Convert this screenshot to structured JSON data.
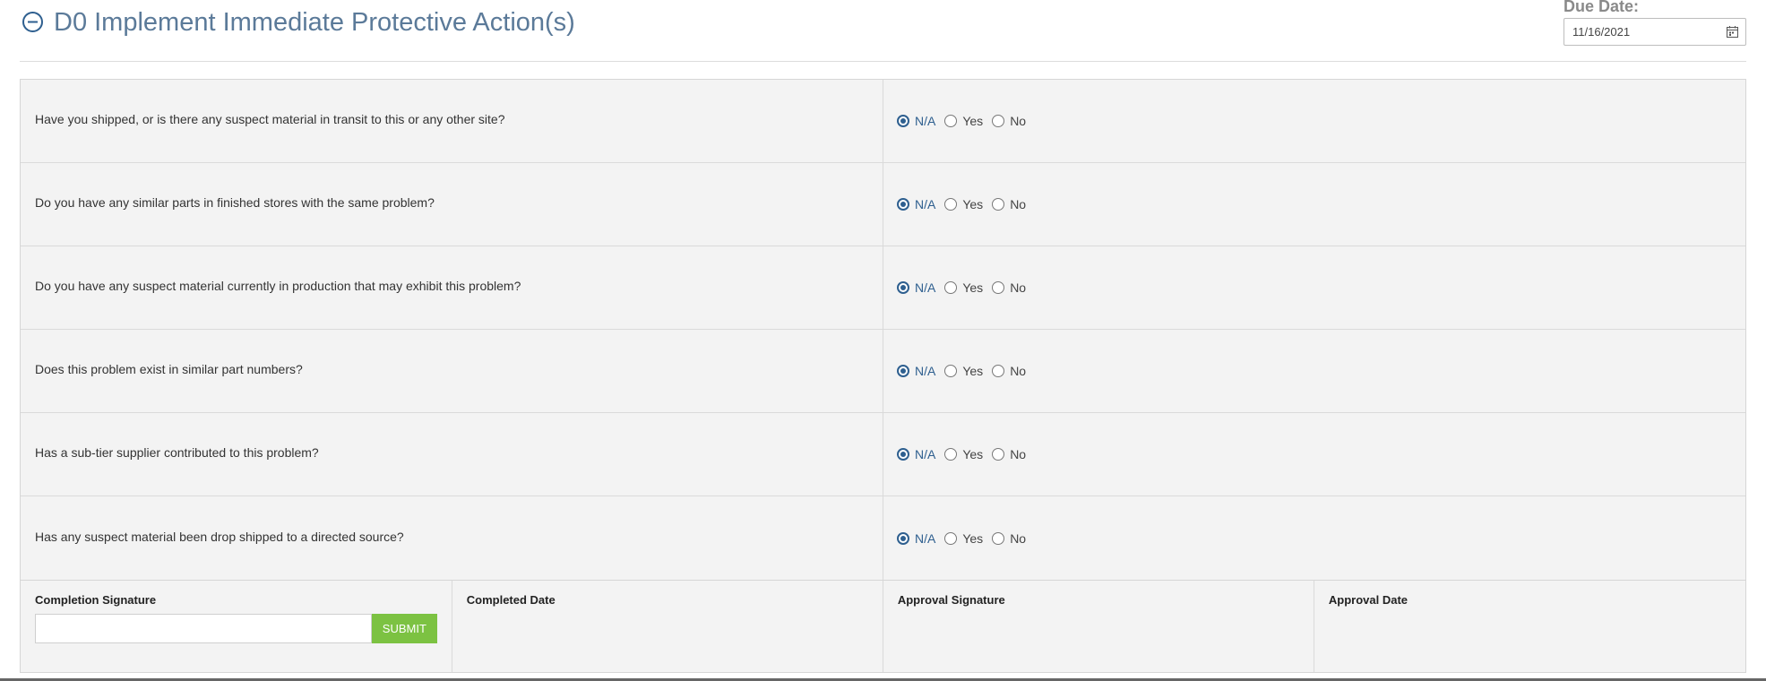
{
  "header": {
    "title": "D0 Implement Immediate Protective Action(s)",
    "due_label": "Due Date:",
    "due_value": "11/16/2021"
  },
  "options": [
    "N/A",
    "Yes",
    "No"
  ],
  "questions": [
    {
      "text": "Have you shipped, or is there any suspect material in transit to this or any other site?",
      "selected": "N/A"
    },
    {
      "text": "Do you have any similar parts in finished stores with the same problem?",
      "selected": "N/A"
    },
    {
      "text": "Do you have any suspect material currently in production that may exhibit this problem?",
      "selected": "N/A"
    },
    {
      "text": "Does this problem exist in similar part numbers?",
      "selected": "N/A"
    },
    {
      "text": "Has a sub-tier supplier contributed to this problem?",
      "selected": "N/A"
    },
    {
      "text": "Has any suspect material been drop shipped to a directed source?",
      "selected": "N/A"
    }
  ],
  "signature": {
    "completion_label": "Completion Signature",
    "completion_value": "",
    "submit_label": "SUBMIT",
    "completed_date_label": "Completed Date",
    "approval_signature_label": "Approval Signature",
    "approval_date_label": "Approval Date"
  },
  "colors": {
    "accent": "#2e5f8f",
    "title": "#5b7a99",
    "submit": "#7cc242",
    "row_bg": "#f3f3f3"
  }
}
